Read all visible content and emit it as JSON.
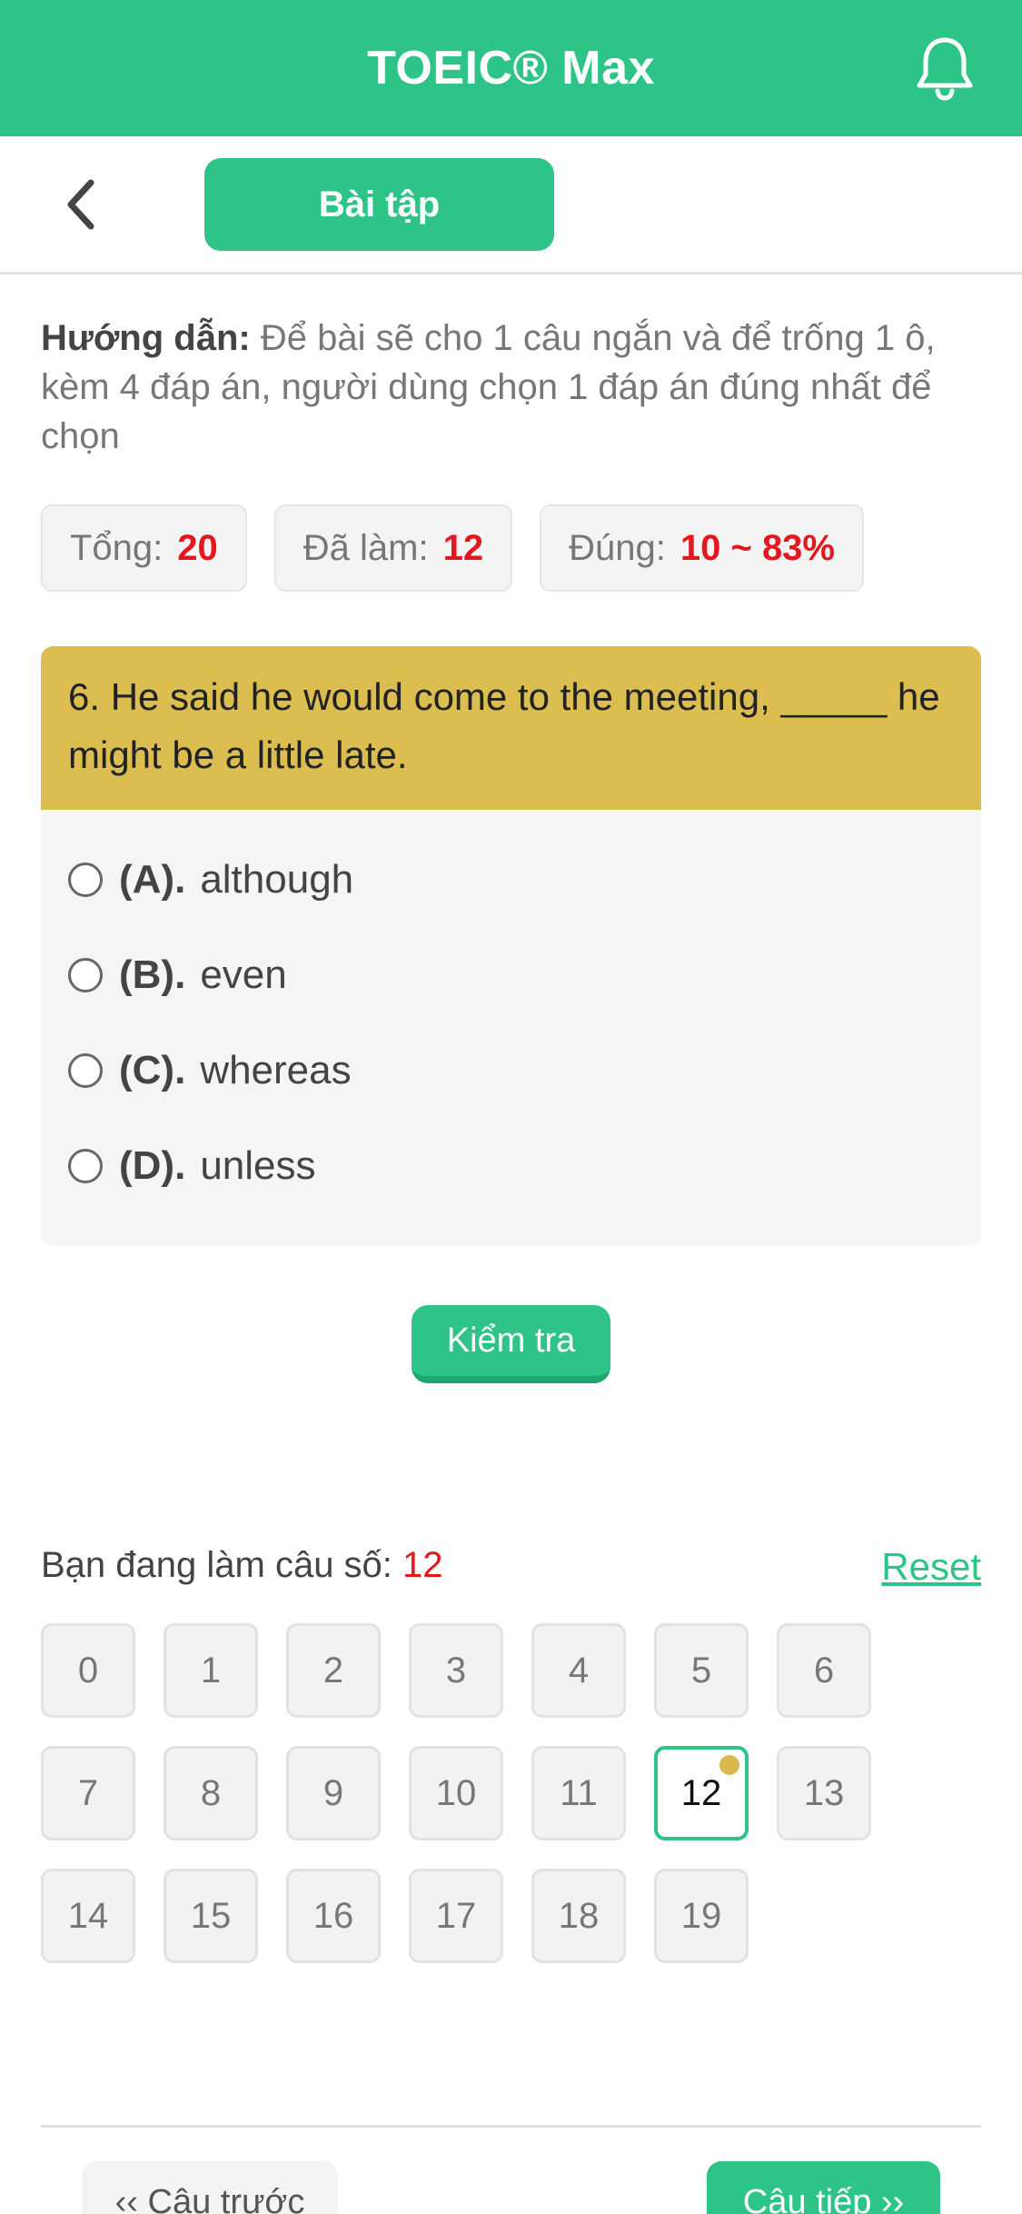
{
  "header": {
    "title": "TOEIC® Max"
  },
  "subbar": {
    "tab_label": "Bài tập"
  },
  "instructions": {
    "label": "Hướng dẫn:",
    "text": "Để bài sẽ cho 1 câu ngắn và để trống 1 ô, kèm 4 đáp án, người dùng chọn 1 đáp án đúng nhất để chọn"
  },
  "stats": [
    {
      "label": "Tổng:",
      "value": "20"
    },
    {
      "label": "Đã làm:",
      "value": "12"
    },
    {
      "label": "Đúng:",
      "value": "10 ~ 83%"
    }
  ],
  "question": {
    "text": "6. He said he would come to the meeting, _____ he might be a little late.",
    "options": [
      {
        "letter": "(A).",
        "text": "although"
      },
      {
        "letter": "(B).",
        "text": "even"
      },
      {
        "letter": "(C).",
        "text": "whereas"
      },
      {
        "letter": "(D).",
        "text": "unless"
      }
    ]
  },
  "check_label": "Kiểm tra",
  "progress": {
    "label": "Bạn đang làm câu số:",
    "current": "12",
    "reset_label": "Reset",
    "numbers": [
      "0",
      "1",
      "2",
      "3",
      "4",
      "5",
      "6",
      "7",
      "8",
      "9",
      "10",
      "11",
      "12",
      "13",
      "14",
      "15",
      "16",
      "17",
      "18",
      "19"
    ]
  },
  "nav": {
    "prev_label": "‹‹ Câu trước",
    "next_label": "Câu tiếp ››"
  },
  "colors": {
    "brand": "#2ec487",
    "question_bg": "#dbbd50",
    "accent_red": "#e3171d"
  }
}
